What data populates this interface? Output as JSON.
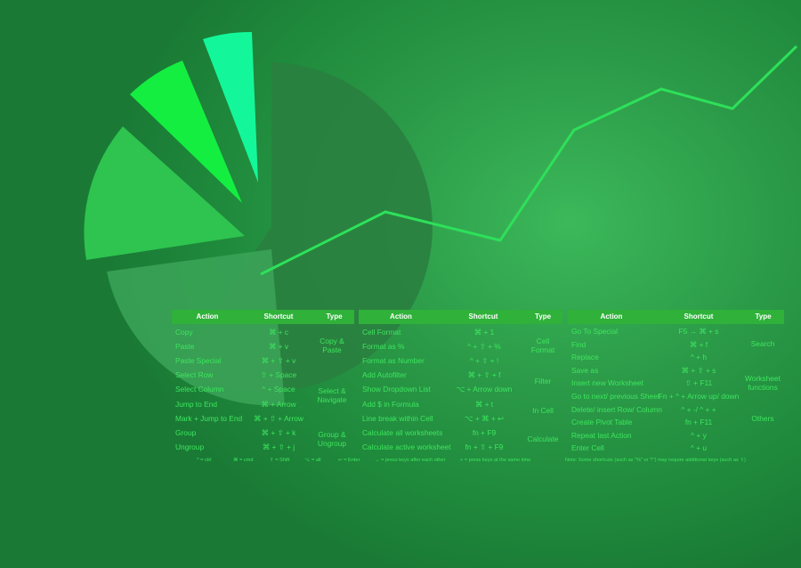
{
  "colors": {
    "background": "#1f8a3c",
    "header_bg": "#2fb13a",
    "header_text": "#ffffff",
    "text": "#3ee65f",
    "line": "#2ee05a",
    "pie": [
      "#2a7f3f",
      "#3ba458",
      "#2ec44f",
      "#14ee40",
      "#13f79a"
    ]
  },
  "headers": {
    "action": "Action",
    "shortcut": "Shortcut",
    "type": "Type"
  },
  "table1": {
    "rows": [
      {
        "action": "Copy",
        "shortcut": "⌘ + c"
      },
      {
        "action": "Paste",
        "shortcut": "⌘ + v"
      },
      {
        "action": "Paste Special",
        "shortcut": "⌘ + ⇧ + v"
      },
      {
        "action": "Select Row",
        "shortcut": "⇧ + Space"
      },
      {
        "action": "Select Column",
        "shortcut": "^ + Space"
      },
      {
        "action": "Jump to End",
        "shortcut": "⌘ + Arrow"
      },
      {
        "action": "Mark + Jump to End",
        "shortcut": "⌘ + ⇧ + Arrow"
      },
      {
        "action": "Group",
        "shortcut": "⌘ + ⇧ + k"
      },
      {
        "action": "Ungroup",
        "shortcut": "⌘ + ⇧ + j"
      }
    ],
    "types": [
      "Copy & Paste",
      "Select & Navigate",
      "Group & Ungroup"
    ],
    "footer": [
      "^ = ctrl",
      "⌘ = cmd",
      "⇧ = Shift",
      "⌥ = alt",
      "↩ = Enter"
    ]
  },
  "table2": {
    "rows": [
      {
        "action": "Cell Format",
        "shortcut": "⌘ + 1"
      },
      {
        "action": "Format as %",
        "shortcut": "^ + ⇧ + %"
      },
      {
        "action": "Format as Number",
        "shortcut": "^ + ⇧ + !"
      },
      {
        "action": "Add Autofilter",
        "shortcut": "⌘ + ⇧ + f"
      },
      {
        "action": "Show Dropdown List",
        "shortcut": "⌥ + Arrow down"
      },
      {
        "action": "Add $ in Formula",
        "shortcut": "⌘ + t"
      },
      {
        "action": "Line break within Cell",
        "shortcut": "⌥ + ⌘ + ↩"
      },
      {
        "action": "Calculate all worksheets",
        "shortcut": "fn + F9"
      },
      {
        "action": "Calculate active worksheet",
        "shortcut": "fn + ⇧ + F9"
      }
    ],
    "types": [
      "Cell Format",
      "Filter",
      "In Cell",
      "Calculate"
    ],
    "footer": [
      "→ = press keys after each other",
      "+ = press keys at the same time"
    ]
  },
  "table3": {
    "rows": [
      {
        "action": "Go To Special",
        "shortcut": "F5 → ⌘ + s"
      },
      {
        "action": "Find",
        "shortcut": "⌘ + f"
      },
      {
        "action": "Replace",
        "shortcut": "^ + h"
      },
      {
        "action": "Save as",
        "shortcut": "⌘ + ⇧ + s"
      },
      {
        "action": "Insert new Worksheet",
        "shortcut": "⇧ + F11"
      },
      {
        "action": "Go to next/ previous Sheet",
        "shortcut": "Fn + ^ + Arrow up/ down"
      },
      {
        "action": "Delete/ insert Row/ Column",
        "shortcut": "^ + -/ ^ + +"
      },
      {
        "action": "Create Pivot Table",
        "shortcut": "fn + F11"
      },
      {
        "action": "Repeat last Action",
        "shortcut": "^ + y"
      },
      {
        "action": "Enter Cell",
        "shortcut": "^ + u"
      }
    ],
    "types": [
      "Search",
      "Worksheet functions",
      "Others"
    ],
    "footer": [
      "Note: Some shortcuts (such as \"%\" or \"!\") may require additional keys (such as ⇧)"
    ]
  }
}
